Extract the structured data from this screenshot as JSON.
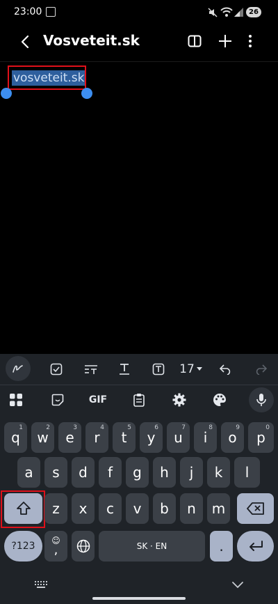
{
  "status_bar": {
    "time": "23:00",
    "battery": "26"
  },
  "header": {
    "title": "Vosveteit.sk"
  },
  "note": {
    "selected_text": "vosveteit.sk"
  },
  "toolbar": {
    "font_size": "17"
  },
  "suggestions": {
    "gif": "GIF"
  },
  "keyboard": {
    "row1": [
      {
        "k": "q",
        "h": "1"
      },
      {
        "k": "w",
        "h": "2"
      },
      {
        "k": "e",
        "h": "3"
      },
      {
        "k": "r",
        "h": "4"
      },
      {
        "k": "t",
        "h": "5"
      },
      {
        "k": "y",
        "h": "6"
      },
      {
        "k": "u",
        "h": "7"
      },
      {
        "k": "i",
        "h": "8"
      },
      {
        "k": "o",
        "h": "9"
      },
      {
        "k": "p",
        "h": "0"
      }
    ],
    "row2": [
      "a",
      "s",
      "d",
      "f",
      "g",
      "h",
      "j",
      "k",
      "l"
    ],
    "row3": [
      "z",
      "x",
      "c",
      "v",
      "b",
      "n",
      "m"
    ],
    "symbols": "?123",
    "comma": ",",
    "space": "SK · EN",
    "period": "."
  },
  "colors": {
    "accent": "#3d8ef0",
    "highlight": "#e0101a",
    "keyboard_bg": "#1f2328",
    "key": "#3b4047"
  }
}
